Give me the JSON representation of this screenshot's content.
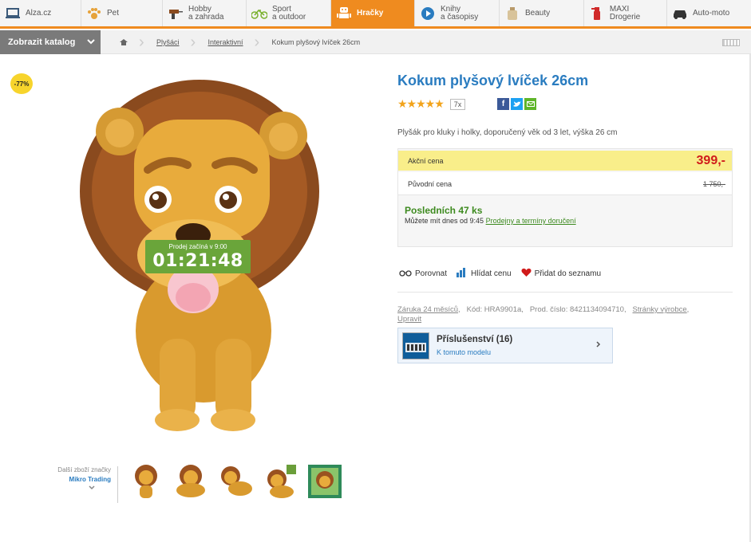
{
  "nav": {
    "tabs": [
      {
        "label": "Alza.cz",
        "icon": "laptop-icon"
      },
      {
        "label": "Pet",
        "icon": "paw-icon"
      },
      {
        "label": "Hobby\na zahrada",
        "icon": "drill-icon"
      },
      {
        "label": "Sport\na outdoor",
        "icon": "bicycle-icon"
      },
      {
        "label": "Hračky",
        "icon": "robot-icon"
      },
      {
        "label": "Knihy\na časopisy",
        "icon": "play-icon"
      },
      {
        "label": "Beauty",
        "icon": "perfume-icon"
      },
      {
        "label": "MAXI Drogerie",
        "icon": "spray-icon"
      },
      {
        "label": "Auto-moto",
        "icon": "car-icon"
      }
    ],
    "active_color": "#ef8b1f"
  },
  "breadcrumb": {
    "catalog_label": "Zobrazit katalog",
    "items": [
      "Plyšáci",
      "Interaktivní"
    ],
    "current": "Kokum plyšový lvíček 26cm"
  },
  "badge": {
    "discount": "-77%"
  },
  "countdown": {
    "label": "Prodej začíná v 9:00",
    "time": "01:21:48"
  },
  "brand": {
    "line1": "Další zboží značky",
    "name": "Mikro Trading"
  },
  "product": {
    "title": "Kokum plyšový lvíček 26cm",
    "stars": "★★★★★",
    "rating_count": "7x",
    "description": "Plyšák pro kluky i holky, doporučený věk od 3 let, výška 26 cm",
    "price_label": "Akční cena",
    "price": "399,-",
    "orig_label": "Původní cena",
    "orig_price": "1 750,-",
    "stock": "Posledních 47 ks",
    "availability": "Můžete mít dnes od 9:45",
    "availability_link": "Prodejny a termíny doručení"
  },
  "actions": {
    "compare": "Porovnat",
    "watch": "Hlídat cenu",
    "wishlist": "Přidat do seznamu"
  },
  "meta": {
    "warranty": "Záruka 24 měsíců",
    "code": "Kód: HRA9901a,",
    "prod_no": "Prod. číslo: 8421134094710,",
    "maker_link": "Stránky výrobce",
    "edit": "Upravit"
  },
  "accessories": {
    "title": "Příslušenství (16)",
    "subtitle": "K tomuto modelu"
  }
}
